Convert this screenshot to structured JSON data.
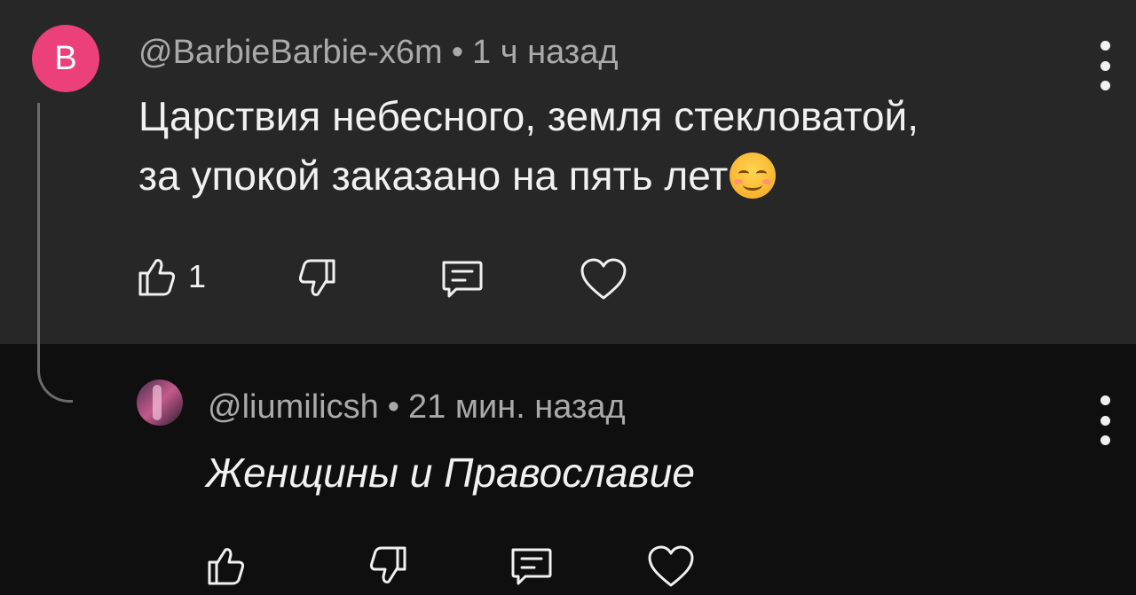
{
  "comment": {
    "avatar_letter": "B",
    "avatar_color": "#ec407a",
    "username": "@BarbieBarbie-x6m",
    "separator": "•",
    "time": "1 ч назад",
    "text_line1": "Царствия небесного, земля стекловатой,",
    "text_line2": "за упокой заказано на пять лет",
    "emoji": "smiling-face-with-blush-emoji",
    "like_count": "1"
  },
  "reply": {
    "username": "@liumilicsh",
    "separator": "•",
    "time": "21 мин. назад",
    "text": "Женщины и Православие"
  },
  "colors": {
    "top_background": "#272727",
    "bottom_background": "#0f0f0f",
    "meta_text": "#aaaaaa",
    "body_text": "#f1f1f1"
  }
}
